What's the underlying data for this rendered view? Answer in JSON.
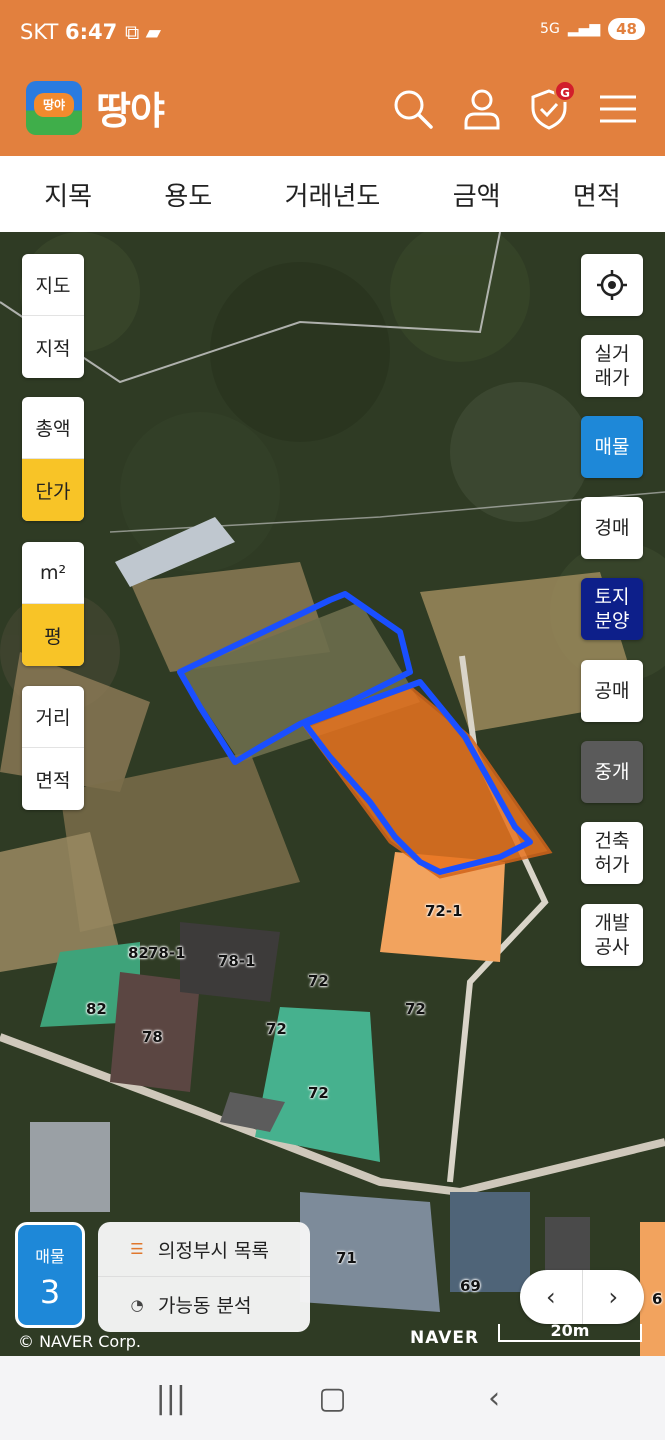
{
  "status": {
    "carrier": "SKT",
    "time": "6:47",
    "network": "5G",
    "battery": "48"
  },
  "header": {
    "app_name": "땅야",
    "logo_badge_text": "땅야",
    "notification_badge": "G"
  },
  "filters": [
    "지목",
    "용도",
    "거래년도",
    "금액",
    "면적"
  ],
  "left_controls": {
    "map_type": [
      "지도",
      "지적"
    ],
    "price_mode": [
      "총액",
      "단가"
    ],
    "unit": [
      "m²",
      "평"
    ],
    "measure": [
      "거리",
      "면적"
    ]
  },
  "right_controls": {
    "locate_icon": "locate-icon",
    "real_trade": "실거래가",
    "listing": "매물",
    "auction": "경매",
    "land_sale": "토지분양",
    "public_auction": "공매",
    "brokerage": "중개",
    "building_permit": "건축허가",
    "development": "개발공사"
  },
  "map_labels": [
    "72-1",
    "82",
    "78-1",
    "78-1",
    "82",
    "78",
    "72",
    "72",
    "72",
    "72",
    "71",
    "69",
    "6"
  ],
  "bottom": {
    "listing_label": "매물",
    "listing_count": "3",
    "list_button": "의정부시 목록",
    "analysis_button": "가능동 분석",
    "copyright": "© NAVER Corp.",
    "naver_logo": "NAVER",
    "scale": "20m"
  },
  "colors": {
    "brand": "#E2803E",
    "active": "#F8C427",
    "listing_blue": "#1e88d8",
    "land_sale_navy": "#0d1f8a",
    "parcel_orange": "#E8731F",
    "outline_blue": "#1a4fff"
  }
}
